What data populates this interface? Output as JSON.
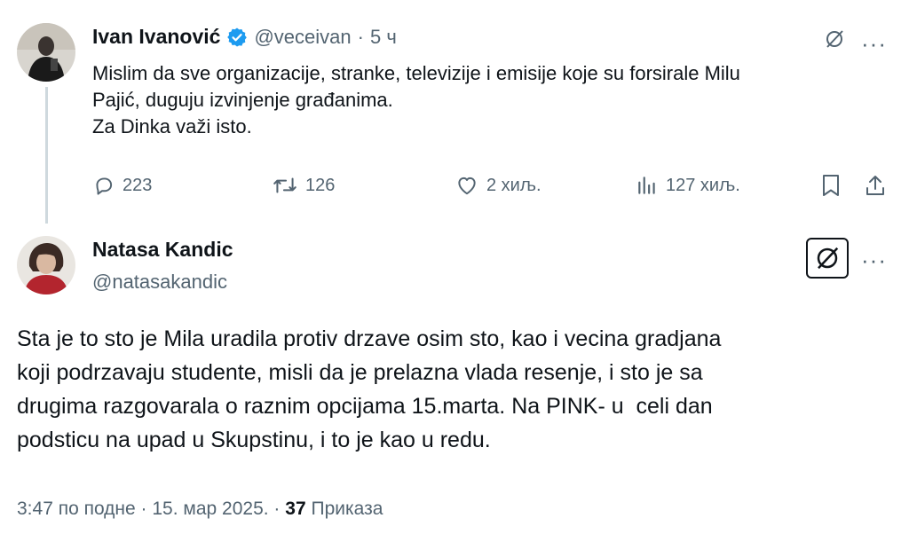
{
  "tweet1": {
    "author_name": "Ivan Ivanović",
    "handle": "@veceivan",
    "separator": "·",
    "time": "5 ч",
    "lines": [
      "Mislim da sve organizacije, stranke, televizije i emisije koje su forsirale Milu",
      "Pajić, duguju izvinjenje građanima.",
      "Za Dinka važi isto."
    ],
    "actions": {
      "replies": "223",
      "reposts": "126",
      "likes": "2 хиљ.",
      "views": "127 хиљ."
    },
    "more_label": "···"
  },
  "tweet2": {
    "author_name": "Natasa Kandic",
    "handle": "@natasakandic",
    "more_label": "···",
    "lines": [
      "Sta je to sto je Mila uradila protiv drzave osim sto, kao i vecina gradjana",
      "koji podrzavaju studente, misli da je prelazna vlada resenje, i sto je sa",
      "drugima razgovarala o raznim opcijama 15.marta. Na PINK- u  celi dan",
      "podsticu na upad u Skupstinu, i to je kao u redu."
    ],
    "timestamp": "3:47 по подне · 15. мар 2025. ·",
    "views_count": "37",
    "views_label": "Приказа"
  },
  "colors": {
    "verified": "#1d9bf0",
    "muted": "#536471",
    "text": "#0f1419",
    "thread_line": "#cfd9de"
  }
}
